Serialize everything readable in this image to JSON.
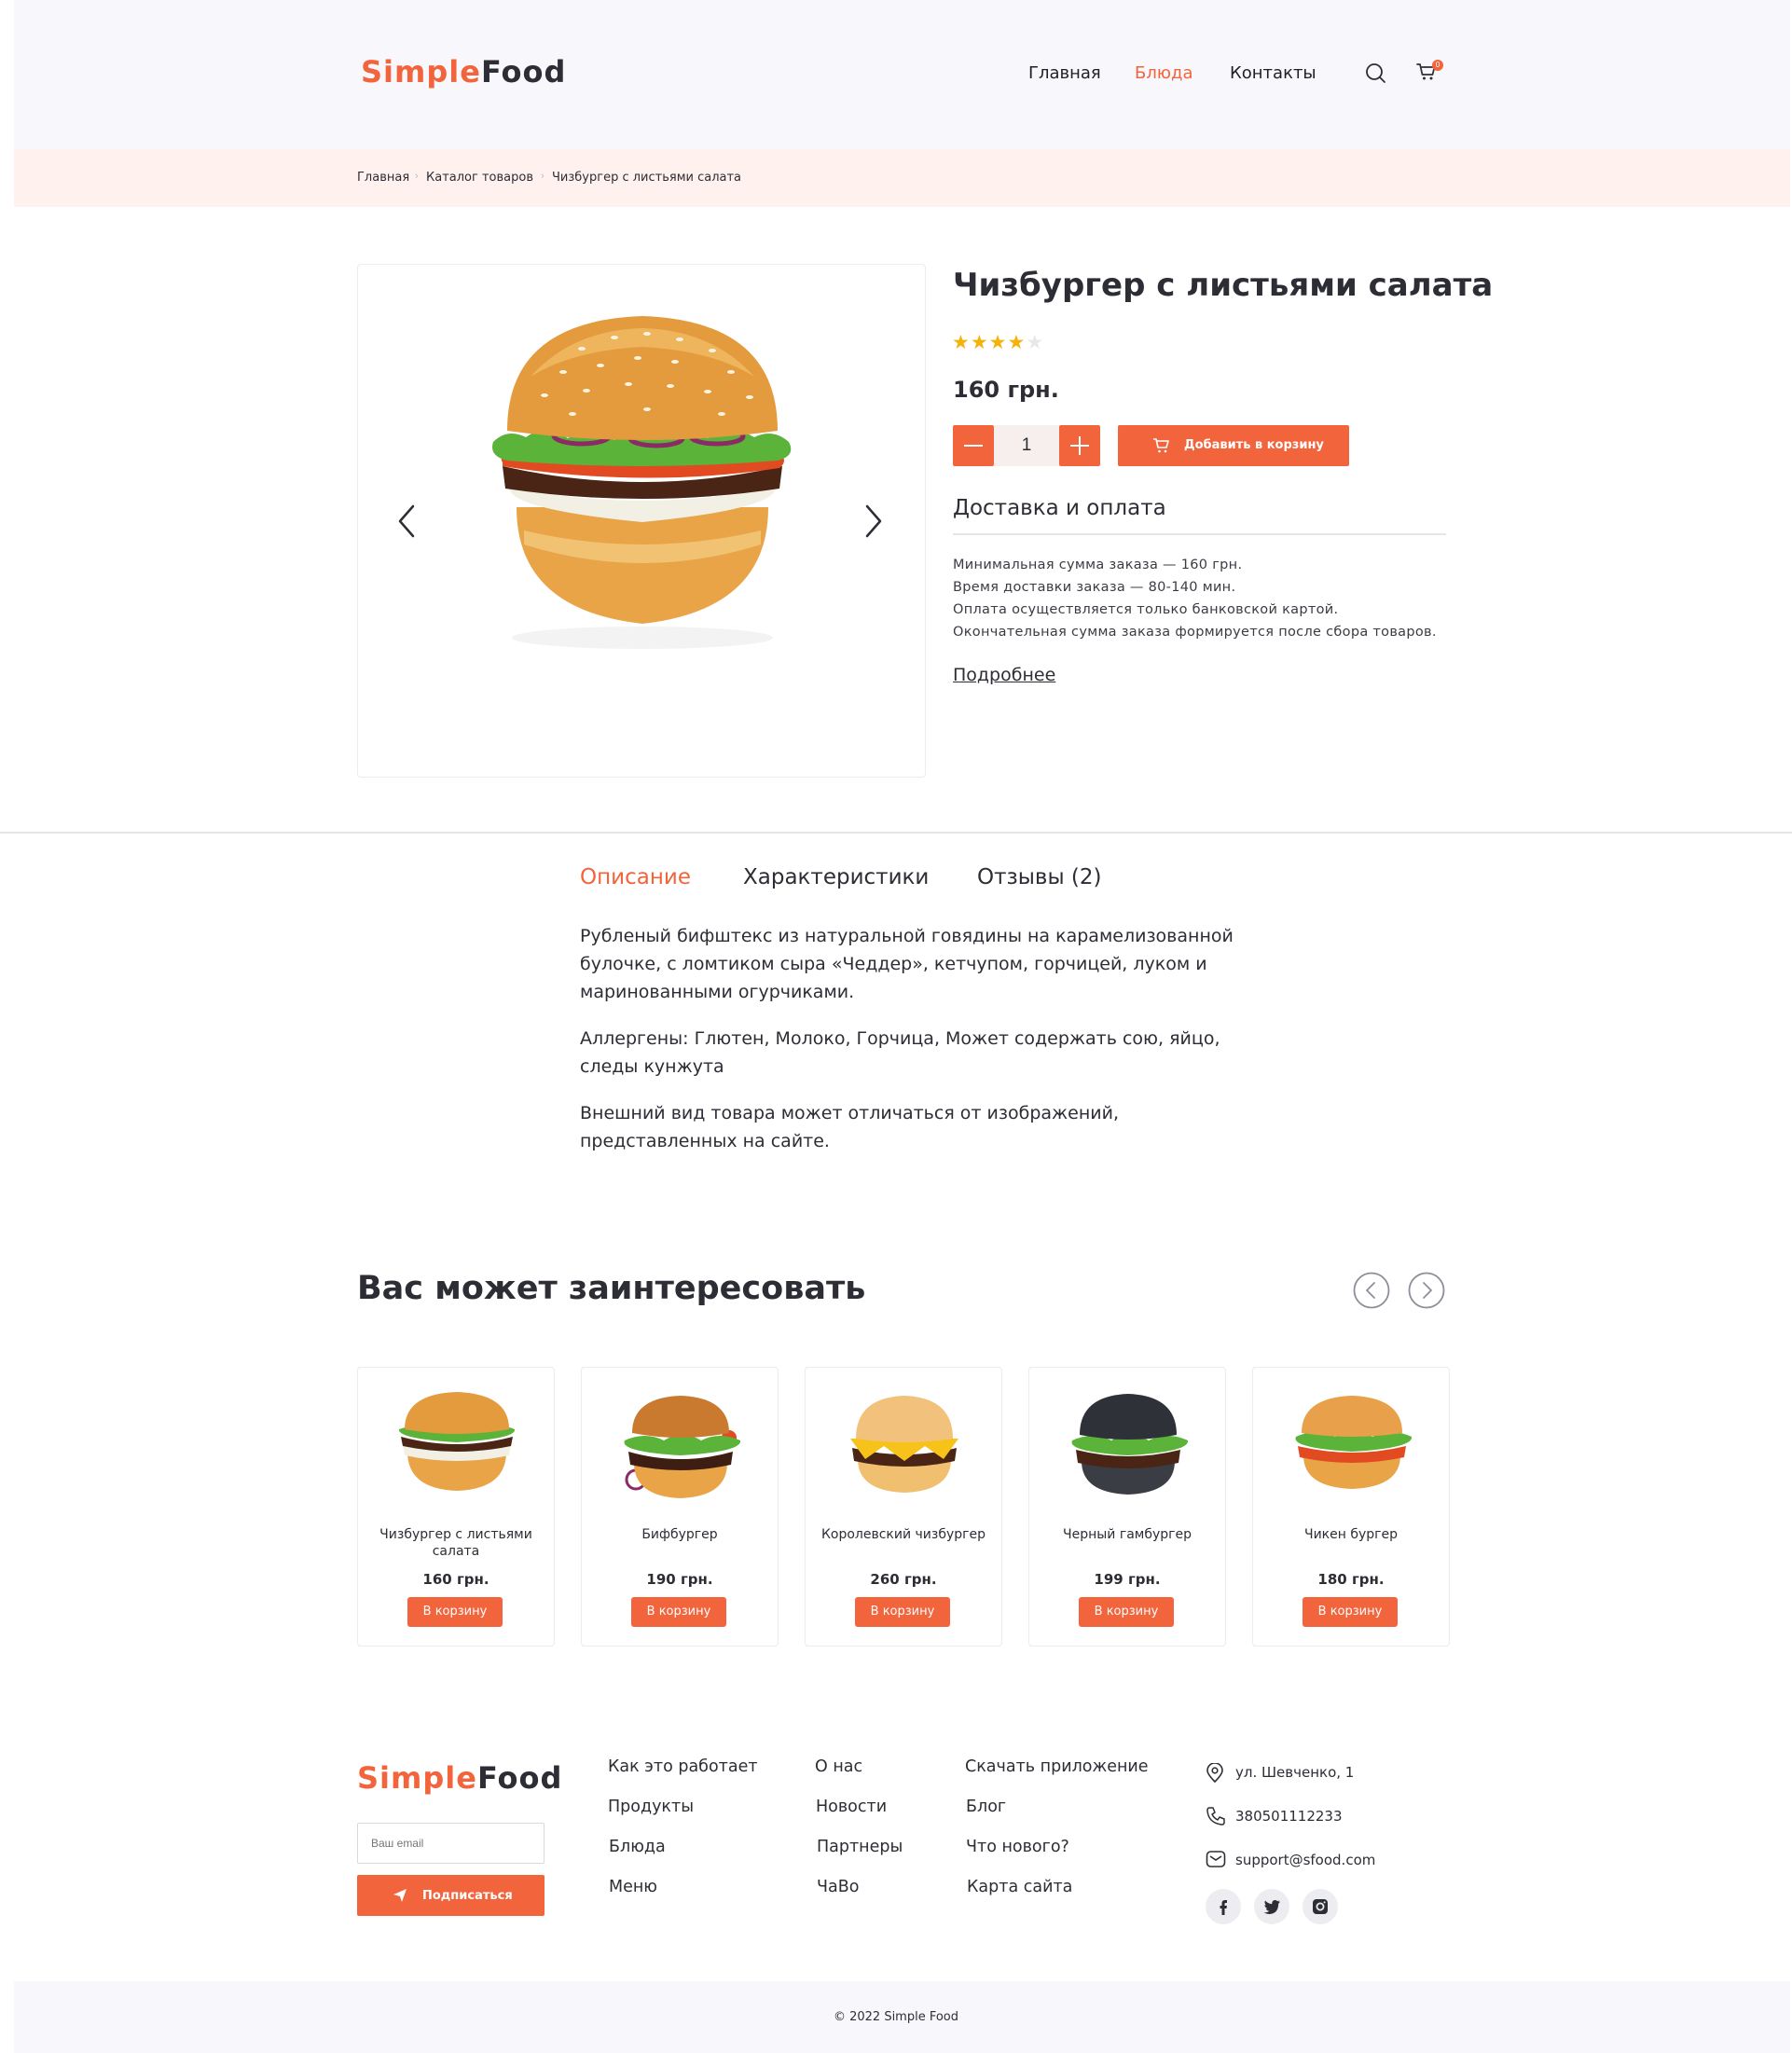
{
  "brand": {
    "part1": "Simple",
    "part2": "Food"
  },
  "nav": {
    "home": "Главная",
    "dishes": "Блюда",
    "contacts": "Контакты",
    "cart_count": "0"
  },
  "breadcrumbs": [
    "Главная",
    "Каталог товаров",
    "Чизбургер с листьями салата"
  ],
  "product": {
    "title": "Чизбургер с листьями салата",
    "rating": 4,
    "rating_max": 5,
    "price": "160 грн.",
    "quantity": "1",
    "add_to_cart": "Добавить в корзину",
    "delivery_title": "Доставка и оплата",
    "delivery_lines": [
      "Минимальная сумма заказа — 160 грн.",
      "Время доставки заказа — 80-140 мин.",
      "Оплата осуществляется только банковской картой.",
      "Окончательная сумма заказа формируется после сбора товаров."
    ],
    "more": "Подробнее"
  },
  "tabs": [
    "Описание",
    "Характеристики",
    "Отзывы (2)"
  ],
  "description": [
    "Рубленый бифштекс из натуральной говядины на карамелизованной булочке, с ломтиком сыра «Чеддер», кетчупом, горчицей, луком и маринованными огурчиками.",
    "Аллергены: Глютен, Молоко, Горчица, Может содержать сою, яйцо, следы кунжута",
    "Внешний вид товара может отличаться от изображений, представленных на сайте."
  ],
  "related": {
    "title": "Вас может заинтересовать",
    "button_label": "В корзину",
    "items": [
      {
        "name": "Чизбургер с листьями салата",
        "price": "160 грн."
      },
      {
        "name": "Бифбургер",
        "price": "190 грн."
      },
      {
        "name": "Королевский чизбургер",
        "price": "260 грн."
      },
      {
        "name": "Черный гамбургер",
        "price": "199 грн."
      },
      {
        "name": "Чикен бургер",
        "price": "180 грн."
      }
    ]
  },
  "footer": {
    "email_placeholder": "Ваш email",
    "subscribe": "Подписаться",
    "col1": [
      "Как это работает",
      "Продукты",
      "Блюда",
      "Меню"
    ],
    "col2": [
      "О нас",
      "Новости",
      "Партнеры",
      "ЧаВо"
    ],
    "col3": [
      "Скачать приложение",
      "Блог",
      "Что нового?",
      "Карта сайта"
    ],
    "address": "ул. Шевченко, 1",
    "phone": "380501112233",
    "email": "support@sfood.com",
    "copyright": "© 2022 Simple Food"
  },
  "colors": {
    "accent": "#f2643c",
    "text": "#2d2d35",
    "star": "#f5b20a"
  }
}
